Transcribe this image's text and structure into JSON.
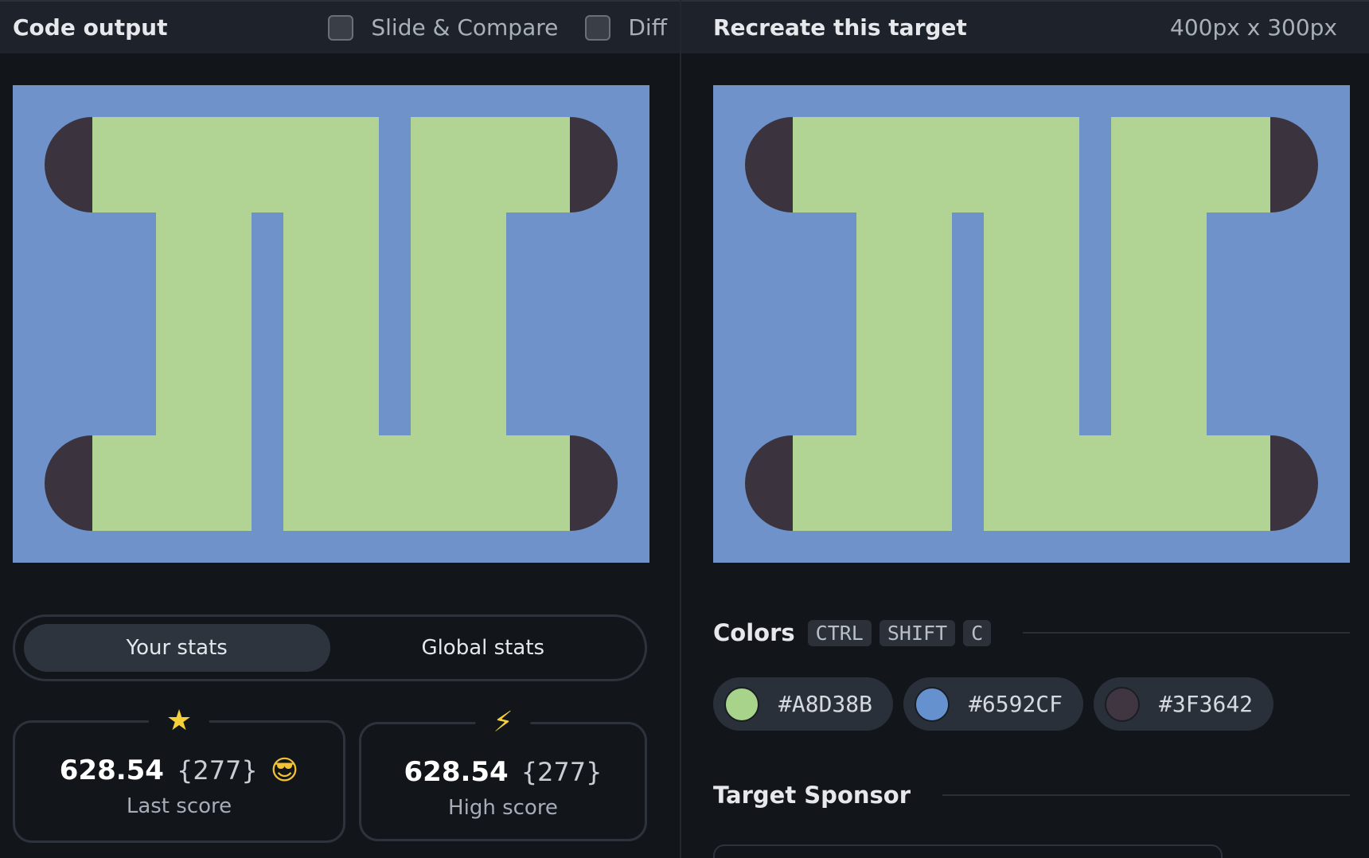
{
  "left_panel": {
    "title": "Code output",
    "toggles": [
      {
        "label": "Slide & Compare",
        "checked": false
      },
      {
        "label": "Diff",
        "checked": false
      }
    ]
  },
  "right_panel": {
    "title": "Recreate this target",
    "dimensions": "400px x 300px"
  },
  "canvas": {
    "background": "#6e92c9",
    "shape_fill": "#b1d393",
    "cap_fill": "#3b343f"
  },
  "stats": {
    "tabs": [
      {
        "label": "Your stats",
        "active": true
      },
      {
        "label": "Global stats",
        "active": false
      }
    ],
    "last_score": {
      "value": "628.54",
      "chars": "{277}",
      "emoji": "😎",
      "label": "Last score",
      "icon": "star-icon"
    },
    "high_score": {
      "value": "628.54",
      "chars": "{277}",
      "label": "High score",
      "icon": "lightning-icon"
    }
  },
  "colors": {
    "title": "Colors",
    "shortcut": [
      "CTRL",
      "SHIFT",
      "C"
    ],
    "swatches": [
      {
        "hex": "#A8D38B",
        "color": "#A8D38B"
      },
      {
        "hex": "#6592CF",
        "color": "#6592CF"
      },
      {
        "hex": "#3F3642",
        "color": "#3F3642"
      }
    ]
  },
  "sponsor": {
    "title": "Target Sponsor"
  }
}
